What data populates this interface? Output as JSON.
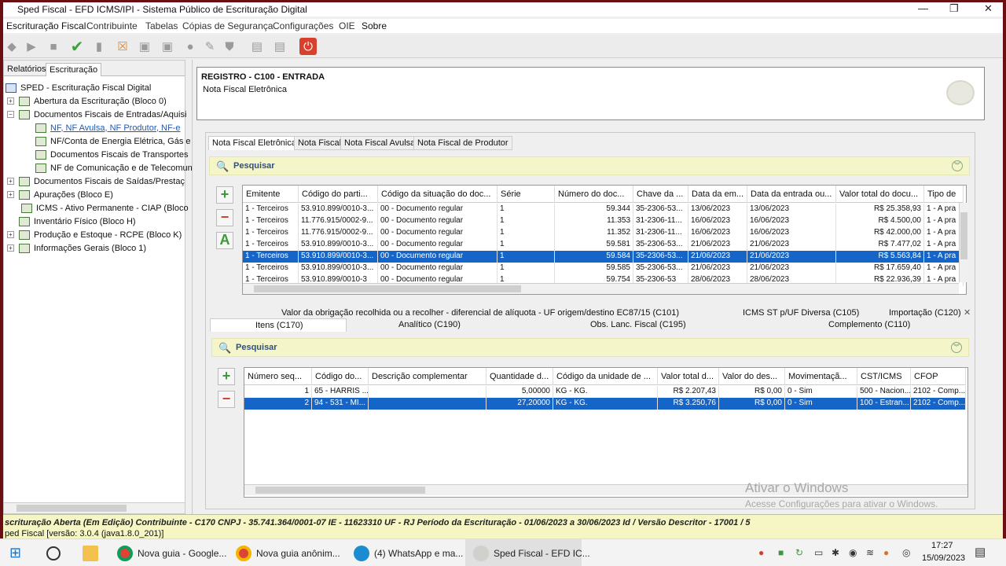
{
  "window": {
    "title": "Sped Fiscal - EFD ICMS/IPI - Sistema Público de Escrituração Digital",
    "minimize": "—",
    "restore": "❐",
    "close": "✕"
  },
  "menu": [
    "Escrituração Fiscal",
    "Contribuinte",
    "Tabelas",
    "Cópias de Segurança",
    "Configurações",
    "OIE",
    "Sobre"
  ],
  "left_tabs": [
    "Relatórios",
    "Escrituração"
  ],
  "tree": {
    "root": "SPED - Escrituração Fiscal Digital",
    "nodes": [
      {
        "label": "Abertura da Escrituração (Bloco 0)",
        "exp": "+"
      },
      {
        "label": "Documentos Fiscais de Entradas/Aquisi",
        "exp": "−"
      },
      {
        "label": "NF, NF Avulsa, NF Produtor, NF-e"
      },
      {
        "label": "NF/Conta de Energia Elétrica, Gás e"
      },
      {
        "label": "Documentos Fiscais de Transportes"
      },
      {
        "label": "NF de Comunicação e de Telecomun"
      },
      {
        "label": "Documentos Fiscais de Saídas/Prestaç",
        "exp": "+"
      },
      {
        "label": "Apurações (Bloco E)",
        "exp": "+"
      },
      {
        "label": "ICMS - Ativo Permanente - CIAP (Bloco"
      },
      {
        "label": "Inventário Físico (Bloco H)"
      },
      {
        "label": "Produção e Estoque - RCPE (Bloco K)",
        "exp": "+"
      },
      {
        "label": "Informações Gerais (Bloco 1)",
        "exp": "+"
      }
    ]
  },
  "header": {
    "title": "REGISTRO - C100 - ENTRADA",
    "subtitle": "Nota Fiscal Eletrônica"
  },
  "doc_tabs": [
    "Nota Fiscal Eletrônica",
    "Nota Fiscal",
    "Nota Fiscal Avulsa",
    "Nota Fiscal de Produtor"
  ],
  "search_label": "Pesquisar",
  "grid1": {
    "columns": [
      "Emitente",
      "Código do parti...",
      "Código da situação do doc...",
      "Série",
      "Número do doc...",
      "Chave da ...",
      "Data da em...",
      "Data da entrada ou...",
      "Valor total do docu...",
      "Tipo de"
    ],
    "rows": [
      [
        "1 - Terceiros",
        "53.910.899/0010-3...",
        "00 - Documento regular",
        "1",
        "59.344",
        "35-2306-53...",
        "13/06/2023",
        "13/06/2023",
        "R$ 25.358,93",
        "1 - A pra"
      ],
      [
        "1 - Terceiros",
        "11.776.915/0002-9...",
        "00 - Documento regular",
        "1",
        "11.353",
        "31-2306-11...",
        "16/06/2023",
        "16/06/2023",
        "R$ 4.500,00",
        "1 - A pra"
      ],
      [
        "1 - Terceiros",
        "11.776.915/0002-9...",
        "00 - Documento regular",
        "1",
        "11.352",
        "31-2306-11...",
        "16/06/2023",
        "16/06/2023",
        "R$ 42.000,00",
        "1 - A pra"
      ],
      [
        "1 - Terceiros",
        "53.910.899/0010-3...",
        "00 - Documento regular",
        "1",
        "59.581",
        "35-2306-53...",
        "21/06/2023",
        "21/06/2023",
        "R$ 7.477,02",
        "1 - A pra"
      ],
      [
        "1 - Terceiros",
        "53.910.899/0010-3...",
        "00 - Documento regular",
        "1",
        "59.584",
        "35-2306-53...",
        "21/06/2023",
        "21/06/2023",
        "R$ 5.563,84",
        "1 - A pra"
      ],
      [
        "1 - Terceiros",
        "53.910.899/0010-3...",
        "00 - Documento regular",
        "1",
        "59.585",
        "35-2306-53...",
        "21/06/2023",
        "21/06/2023",
        "R$ 17.659,40",
        "1 - A pra"
      ],
      [
        "1 - Terceiros",
        "53.910.899/0010-3",
        "00 - Documento regular",
        "1",
        "59.754",
        "35-2306-53",
        "28/06/2023",
        "28/06/2023",
        "R$ 22.936,39",
        "1 - A pra"
      ]
    ],
    "selected": 4
  },
  "sub_tabs_top": [
    "Valor da obrigação recolhida ou a recolher - diferencial de alíquota - UF origem/destino EC87/15 (C101)",
    "ICMS ST p/UF Diversa (C105)",
    "Importação (C120)"
  ],
  "sub_tabs_bottom": [
    "Itens (C170)",
    "Analítico (C190)",
    "Obs. Lanc. Fiscal (C195)",
    "Complemento (C110)"
  ],
  "grid2": {
    "columns": [
      "Número seq...",
      "Código do...",
      "Descrição complementar",
      "Quantidade d...",
      "Código da unidade de ...",
      "Valor total d...",
      "Valor do des...",
      "Movimentaçã...",
      "CST/ICMS",
      "CFOP"
    ],
    "rows": [
      [
        "1",
        "65 - HARRIS ...",
        "",
        "5,00000",
        "KG - KG.",
        "R$ 2.207,43",
        "R$ 0,00",
        "0 - Sim",
        "500 - Nacion...",
        "2102 - Comp..."
      ],
      [
        "2",
        "94 - 531 - MI...",
        "",
        "27,20000",
        "KG - KG.",
        "R$ 3.250,76",
        "R$ 0,00",
        "0 - Sim",
        "100 - Estran...",
        "2102 - Comp..."
      ]
    ],
    "selected": 1
  },
  "status": {
    "line1": "scrituração Aberta (Em Edição) Contribuinte - C170 CNPJ - 35.741.364/0001-07 IE - 11623310 UF - RJ Período da Escrituração - 01/06/2023 a 30/06/2023 Id / Versão Descritor - 17001 / 5",
    "line2": "ped Fiscal [versão: 3.0.4 (java1.8.0_201)]"
  },
  "watermark": {
    "line1": "Ativar o Windows",
    "line2": "Acesse Configurações para ativar o Windows."
  },
  "taskbar": {
    "items": [
      "Nova guia - Google...",
      "Nova guia anônim...",
      "(4) WhatsApp e ma...",
      "Sped Fiscal - EFD IC..."
    ],
    "time": "17:27",
    "date": "15/09/2023"
  },
  "icons": {
    "add": "+",
    "remove": "−",
    "edit": "A",
    "search": "🔍",
    "chevron": "︾",
    "power": "⏻"
  }
}
